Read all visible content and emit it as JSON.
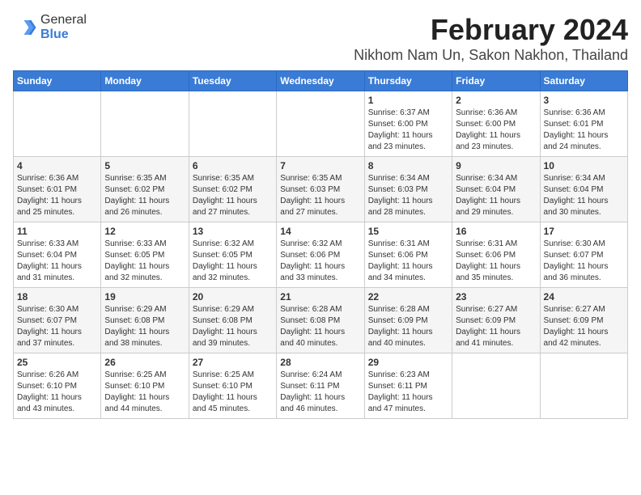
{
  "header": {
    "logo_general": "General",
    "logo_blue": "Blue",
    "month_title": "February 2024",
    "location": "Nikhom Nam Un, Sakon Nakhon, Thailand"
  },
  "days_of_week": [
    "Sunday",
    "Monday",
    "Tuesday",
    "Wednesday",
    "Thursday",
    "Friday",
    "Saturday"
  ],
  "weeks": [
    [
      {
        "day": "",
        "info": ""
      },
      {
        "day": "",
        "info": ""
      },
      {
        "day": "",
        "info": ""
      },
      {
        "day": "",
        "info": ""
      },
      {
        "day": "1",
        "info": "Sunrise: 6:37 AM\nSunset: 6:00 PM\nDaylight: 11 hours\nand 23 minutes."
      },
      {
        "day": "2",
        "info": "Sunrise: 6:36 AM\nSunset: 6:00 PM\nDaylight: 11 hours\nand 23 minutes."
      },
      {
        "day": "3",
        "info": "Sunrise: 6:36 AM\nSunset: 6:01 PM\nDaylight: 11 hours\nand 24 minutes."
      }
    ],
    [
      {
        "day": "4",
        "info": "Sunrise: 6:36 AM\nSunset: 6:01 PM\nDaylight: 11 hours\nand 25 minutes."
      },
      {
        "day": "5",
        "info": "Sunrise: 6:35 AM\nSunset: 6:02 PM\nDaylight: 11 hours\nand 26 minutes."
      },
      {
        "day": "6",
        "info": "Sunrise: 6:35 AM\nSunset: 6:02 PM\nDaylight: 11 hours\nand 27 minutes."
      },
      {
        "day": "7",
        "info": "Sunrise: 6:35 AM\nSunset: 6:03 PM\nDaylight: 11 hours\nand 27 minutes."
      },
      {
        "day": "8",
        "info": "Sunrise: 6:34 AM\nSunset: 6:03 PM\nDaylight: 11 hours\nand 28 minutes."
      },
      {
        "day": "9",
        "info": "Sunrise: 6:34 AM\nSunset: 6:04 PM\nDaylight: 11 hours\nand 29 minutes."
      },
      {
        "day": "10",
        "info": "Sunrise: 6:34 AM\nSunset: 6:04 PM\nDaylight: 11 hours\nand 30 minutes."
      }
    ],
    [
      {
        "day": "11",
        "info": "Sunrise: 6:33 AM\nSunset: 6:04 PM\nDaylight: 11 hours\nand 31 minutes."
      },
      {
        "day": "12",
        "info": "Sunrise: 6:33 AM\nSunset: 6:05 PM\nDaylight: 11 hours\nand 32 minutes."
      },
      {
        "day": "13",
        "info": "Sunrise: 6:32 AM\nSunset: 6:05 PM\nDaylight: 11 hours\nand 32 minutes."
      },
      {
        "day": "14",
        "info": "Sunrise: 6:32 AM\nSunset: 6:06 PM\nDaylight: 11 hours\nand 33 minutes."
      },
      {
        "day": "15",
        "info": "Sunrise: 6:31 AM\nSunset: 6:06 PM\nDaylight: 11 hours\nand 34 minutes."
      },
      {
        "day": "16",
        "info": "Sunrise: 6:31 AM\nSunset: 6:06 PM\nDaylight: 11 hours\nand 35 minutes."
      },
      {
        "day": "17",
        "info": "Sunrise: 6:30 AM\nSunset: 6:07 PM\nDaylight: 11 hours\nand 36 minutes."
      }
    ],
    [
      {
        "day": "18",
        "info": "Sunrise: 6:30 AM\nSunset: 6:07 PM\nDaylight: 11 hours\nand 37 minutes."
      },
      {
        "day": "19",
        "info": "Sunrise: 6:29 AM\nSunset: 6:08 PM\nDaylight: 11 hours\nand 38 minutes."
      },
      {
        "day": "20",
        "info": "Sunrise: 6:29 AM\nSunset: 6:08 PM\nDaylight: 11 hours\nand 39 minutes."
      },
      {
        "day": "21",
        "info": "Sunrise: 6:28 AM\nSunset: 6:08 PM\nDaylight: 11 hours\nand 40 minutes."
      },
      {
        "day": "22",
        "info": "Sunrise: 6:28 AM\nSunset: 6:09 PM\nDaylight: 11 hours\nand 40 minutes."
      },
      {
        "day": "23",
        "info": "Sunrise: 6:27 AM\nSunset: 6:09 PM\nDaylight: 11 hours\nand 41 minutes."
      },
      {
        "day": "24",
        "info": "Sunrise: 6:27 AM\nSunset: 6:09 PM\nDaylight: 11 hours\nand 42 minutes."
      }
    ],
    [
      {
        "day": "25",
        "info": "Sunrise: 6:26 AM\nSunset: 6:10 PM\nDaylight: 11 hours\nand 43 minutes."
      },
      {
        "day": "26",
        "info": "Sunrise: 6:25 AM\nSunset: 6:10 PM\nDaylight: 11 hours\nand 44 minutes."
      },
      {
        "day": "27",
        "info": "Sunrise: 6:25 AM\nSunset: 6:10 PM\nDaylight: 11 hours\nand 45 minutes."
      },
      {
        "day": "28",
        "info": "Sunrise: 6:24 AM\nSunset: 6:11 PM\nDaylight: 11 hours\nand 46 minutes."
      },
      {
        "day": "29",
        "info": "Sunrise: 6:23 AM\nSunset: 6:11 PM\nDaylight: 11 hours\nand 47 minutes."
      },
      {
        "day": "",
        "info": ""
      },
      {
        "day": "",
        "info": ""
      }
    ]
  ]
}
